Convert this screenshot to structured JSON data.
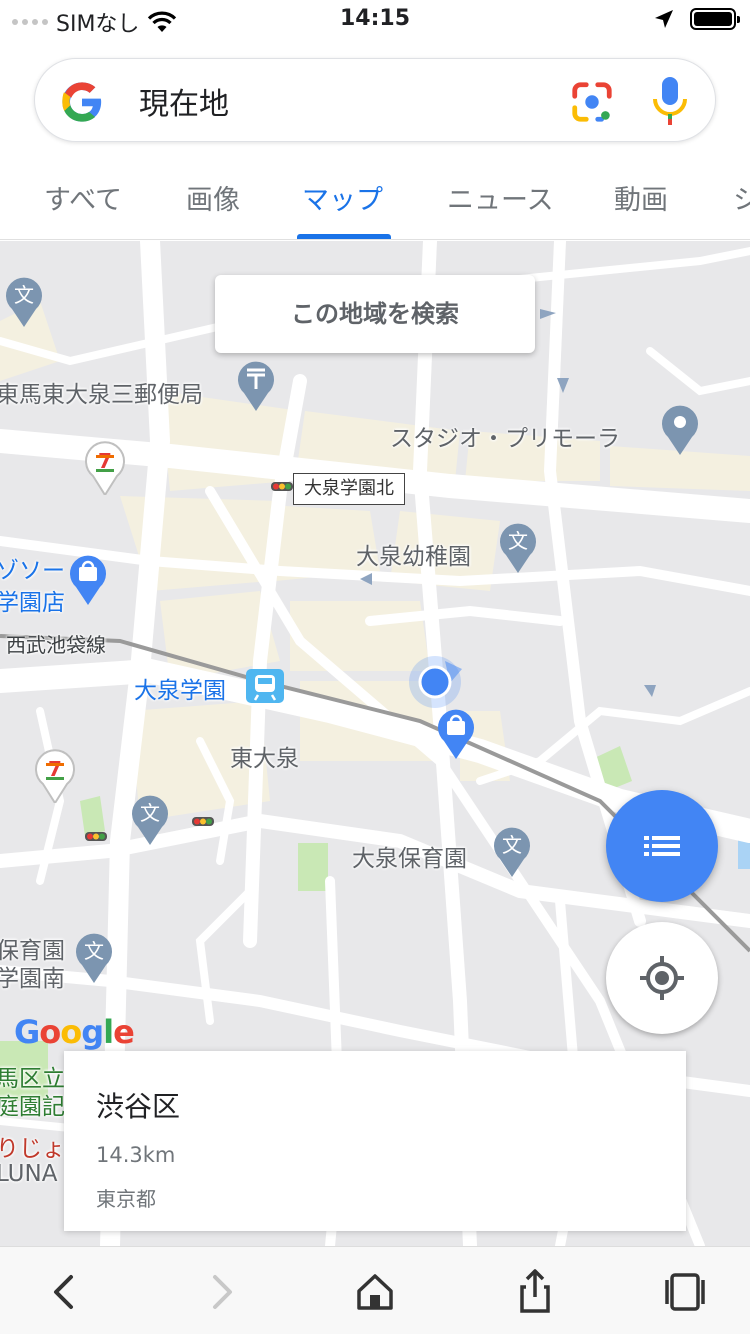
{
  "status_bar": {
    "carrier": "SIMなし",
    "time": "14:15"
  },
  "search": {
    "query": "現在地"
  },
  "tabs": [
    {
      "label": "すべて",
      "active": false
    },
    {
      "label": "画像",
      "active": false
    },
    {
      "label": "マップ",
      "active": true
    },
    {
      "label": "ニュース",
      "active": false
    },
    {
      "label": "動画",
      "active": false
    },
    {
      "label": "シ",
      "active": false
    }
  ],
  "map": {
    "search_area_label": "この地域を検索",
    "bus_stop_label": "大泉学園北",
    "watermark": "Google",
    "labels": {
      "post_office": "東馬東大泉三郵便局",
      "studio": "スタジオ・プリモーラ",
      "kindergarten": "大泉幼稚園",
      "store_line1": "ゾソー",
      "store_line2": "学園店",
      "rail_line": "西武池袋線",
      "station": "大泉学園",
      "area": "東大泉",
      "nursery": "大泉保育園",
      "left_nursery_line1": "保育園",
      "left_nursery_line2": "学園南",
      "park_line1": "馬区立",
      "park_line2": "庭園記",
      "shop_line1": "りじょ",
      "shop_line2": "LUNA"
    }
  },
  "info_card": {
    "name": "渋谷区",
    "distance": "14.3km",
    "region": "東京都"
  },
  "colors": {
    "accent": "#1a73e8",
    "fab": "#4285f4",
    "map_bg": "#e8e8ea",
    "residential": "#f4f0e0",
    "pin": "#7c95b0"
  }
}
